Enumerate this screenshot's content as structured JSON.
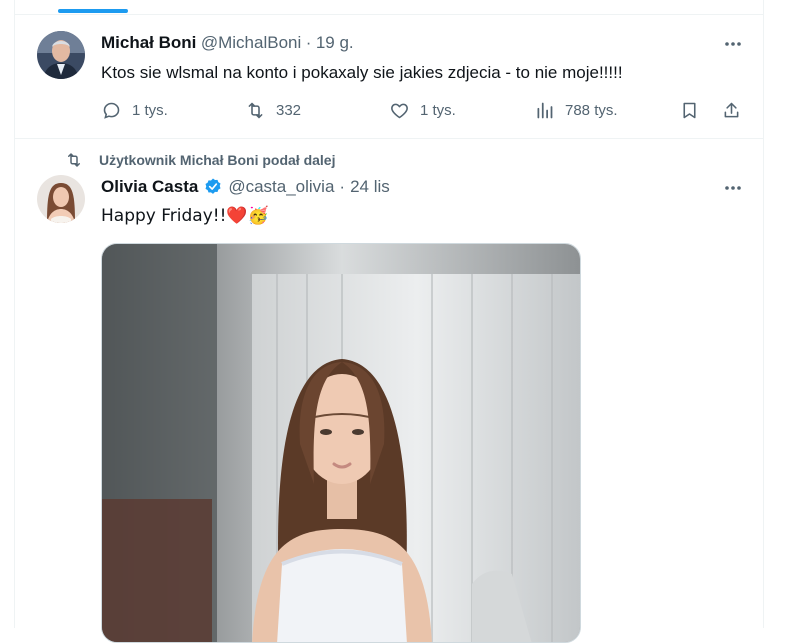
{
  "tweet1": {
    "author_name": "Michał Boni",
    "handle": "@MichalBoni",
    "dot": "·",
    "time": "19 g.",
    "text": "Ktos sie wlsmal na konto i pokaxaly sie jakies zdjecia - to nie moje!!!!!",
    "actions": {
      "reply_count": "1 tys.",
      "retweet_count": "332",
      "like_count": "1 tys.",
      "view_count": "788 tys."
    }
  },
  "tweet2": {
    "retweet_banner": "Użytkownik Michał Boni podał dalej",
    "author_name": "Olivia Casta",
    "handle": "@casta_olivia",
    "dot": "·",
    "time": "24 lis",
    "text": "Happy Friday!!❤️🥳"
  },
  "colors": {
    "accent": "#1d9bf0",
    "muted": "#536471",
    "border": "#eff3f4"
  },
  "icons": [
    "more-icon",
    "reply-icon",
    "retweet-icon",
    "like-icon",
    "views-icon",
    "bookmark-icon",
    "share-icon",
    "verified-icon"
  ]
}
